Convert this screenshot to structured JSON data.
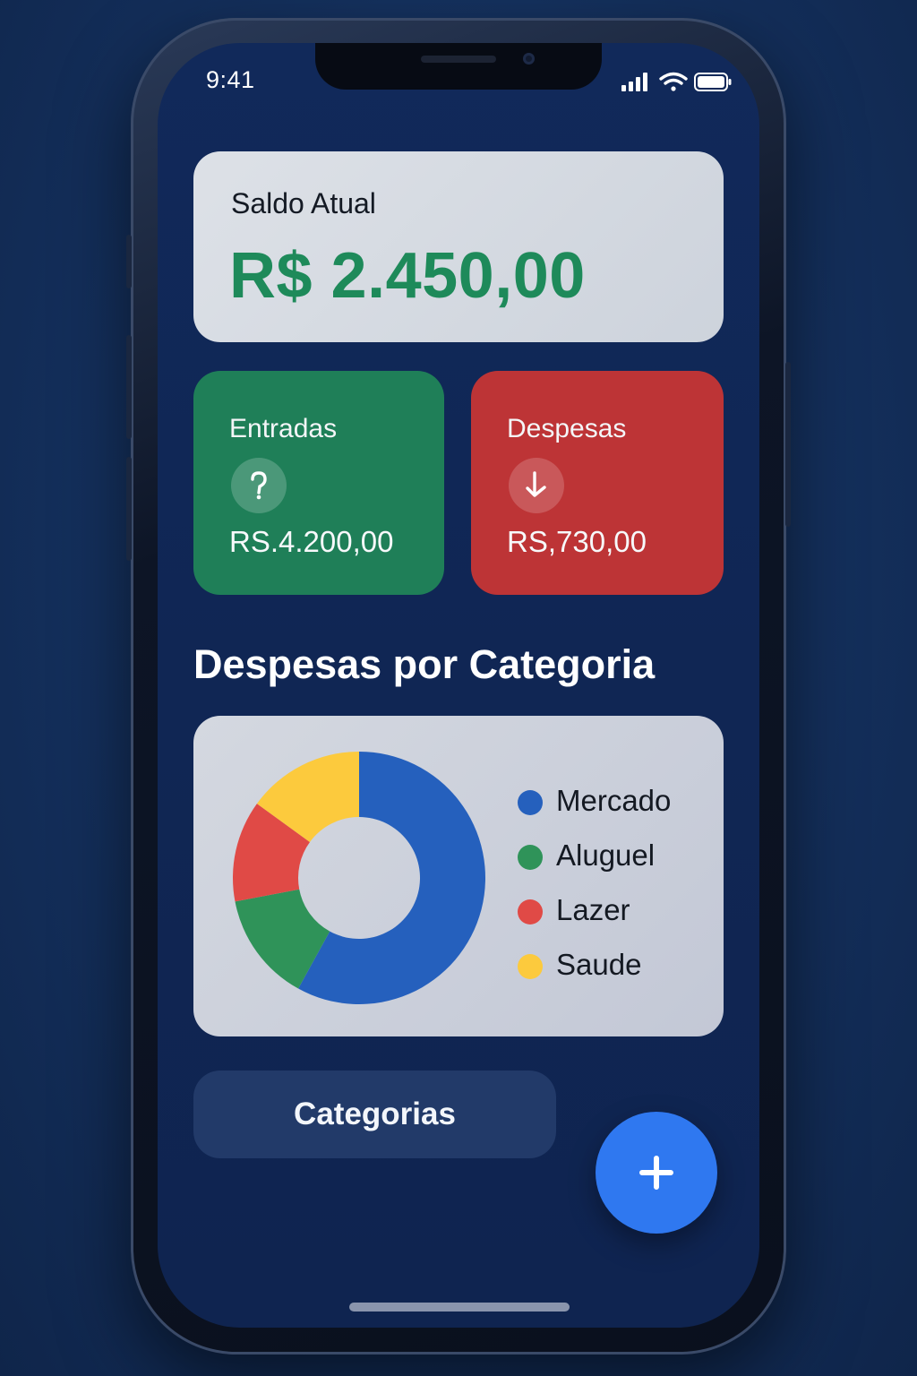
{
  "status_bar": {
    "time": "9:41",
    "icons": [
      "signal-icon",
      "wifi-icon",
      "battery-icon"
    ]
  },
  "balance": {
    "label": "Saldo Atual",
    "value": "R$ 2.450,00"
  },
  "income": {
    "label": "Entradas",
    "icon": "arrow-up-icon",
    "value": "RS.4.200,00"
  },
  "expenses": {
    "label": "Despesas",
    "icon": "arrow-down-icon",
    "value": "RS,730,00"
  },
  "section": {
    "title": "Despesas por Categoria"
  },
  "chart_data": {
    "type": "pie",
    "variant": "donut",
    "categories": [
      "Mercado",
      "Aluguel",
      "Lazer",
      "Saude"
    ],
    "values": [
      58,
      14,
      13,
      15
    ],
    "colors": [
      "#2560bd",
      "#2f9359",
      "#e04a46",
      "#fcca3d"
    ],
    "legend_position": "right"
  },
  "legend": {
    "items": [
      {
        "label": "Mercado",
        "color": "#2560bd"
      },
      {
        "label": "Aluguel",
        "color": "#2f9359"
      },
      {
        "label": "Lazer",
        "color": "#e04a46"
      },
      {
        "label": "Saude",
        "color": "#fcca3d"
      }
    ]
  },
  "buttons": {
    "categories_label": "Categorias",
    "fab_icon": "plus-icon"
  },
  "colors": {
    "background": "#13305d",
    "balance_value": "#1e8a5a",
    "income_card": "#1f7f58",
    "expense_card": "#bd3436",
    "fab": "#2f78f0"
  }
}
